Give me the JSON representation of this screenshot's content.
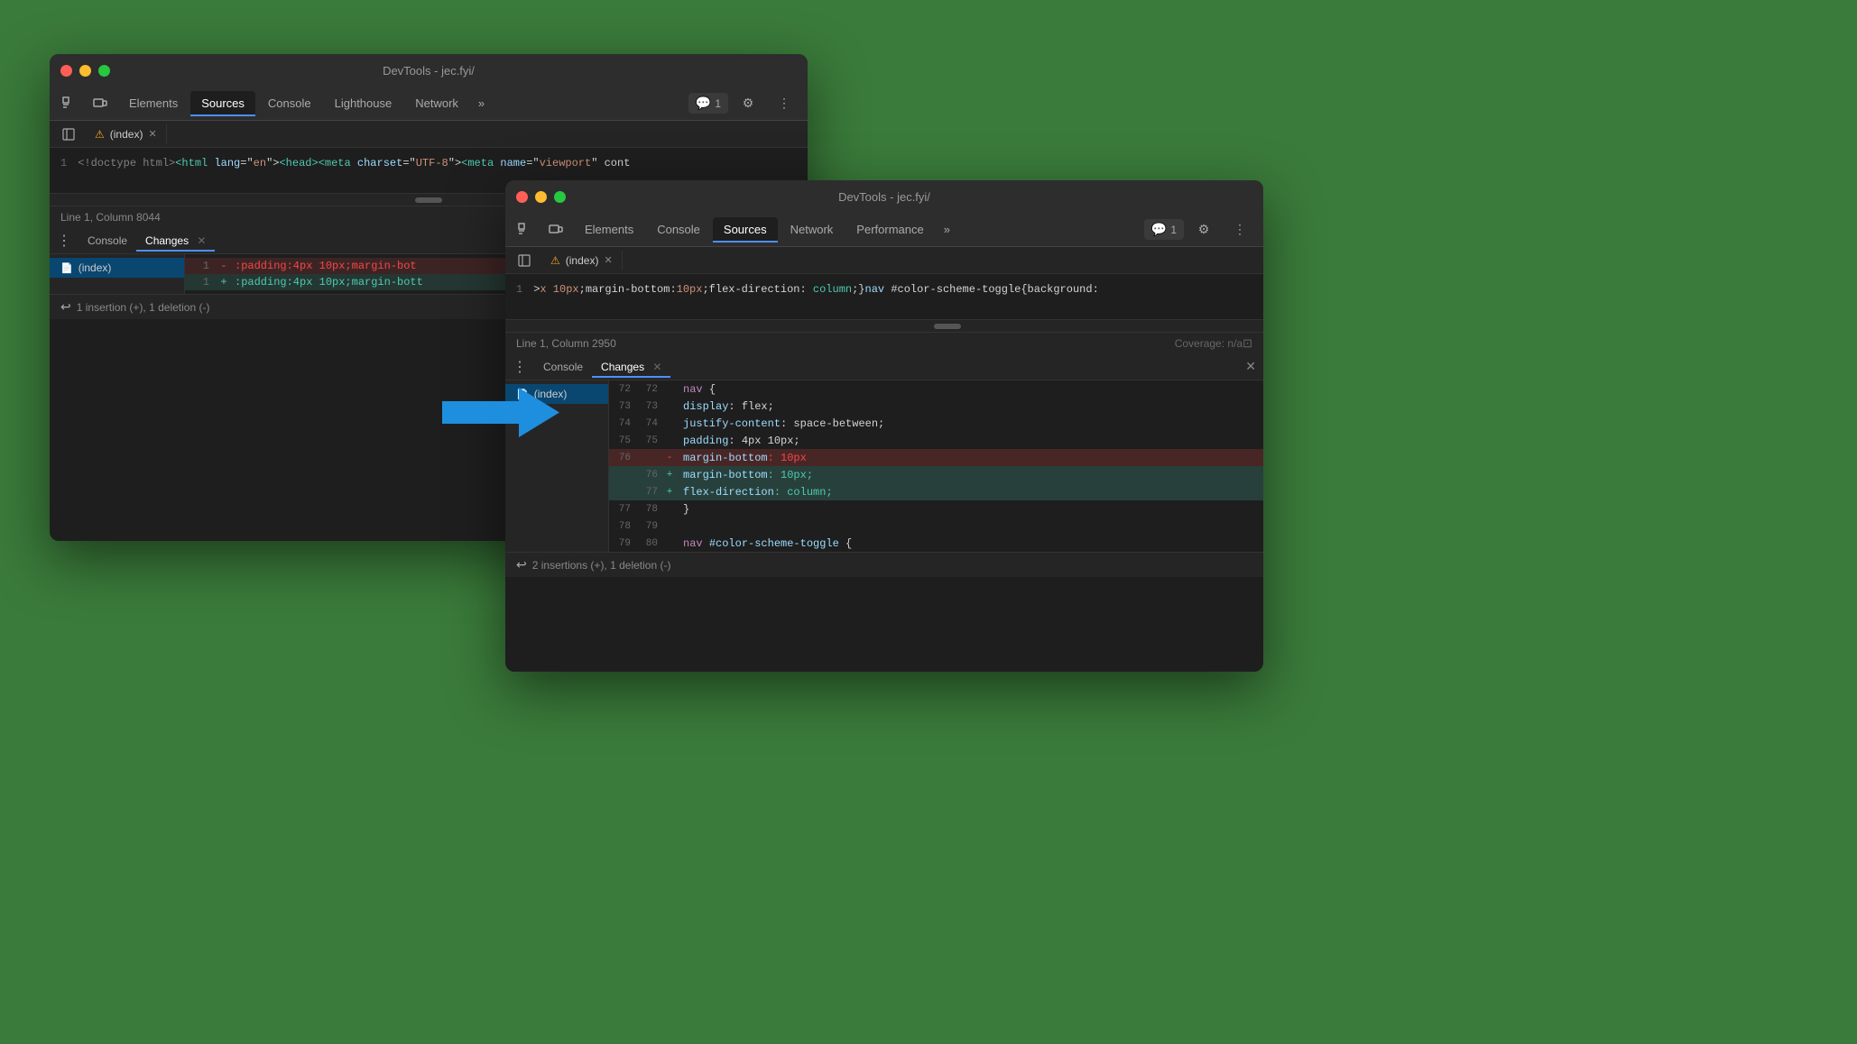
{
  "window_back": {
    "title": "DevTools - jec.fyi/",
    "tabs": [
      "Elements",
      "Sources",
      "Console",
      "Lighthouse",
      "Network",
      "»"
    ],
    "active_tab": "Sources",
    "file_tab": "(index)",
    "code_line": "<!doctype html><html lang=\"en\"><head><meta charset=\"UTF-8\"><meta name=\"viewport\" conte",
    "line_num": "1",
    "status": "Line 1, Column 8044",
    "panel_tabs": [
      "Console",
      "Changes"
    ],
    "active_panel_tab": "Changes",
    "changes_file": "(index)",
    "diff_lines": [
      {
        "old_num": "1",
        "new_num": "",
        "sign": "-",
        "code": ":padding:4px 10px;margin-bot",
        "type": "removed"
      },
      {
        "old_num": "",
        "new_num": "1",
        "sign": "+",
        "code": ":padding:4px 10px;margin-bott",
        "type": "added"
      }
    ],
    "footer": "1 insertion (+), 1 deletion (-)",
    "badge": "1"
  },
  "window_front": {
    "title": "DevTools - jec.fyi/",
    "tabs": [
      "Elements",
      "Console",
      "Sources",
      "Network",
      "Performance",
      "»"
    ],
    "active_tab": "Sources",
    "file_tab": "(index)",
    "code_line": ">x 10px;margin-bottom:10px;flex-direction: column;}nav #color-scheme-toggle{background:",
    "line_num": "1",
    "status": "Line 1, Column 2950",
    "coverage": "Coverage: n/a",
    "panel_tabs": [
      "Console",
      "Changes"
    ],
    "active_panel_tab": "Changes",
    "changes_file": "(index)",
    "diff_rows": [
      {
        "old_num": "72",
        "new_num": "72",
        "sign": "",
        "code": "        nav {",
        "type": "context"
      },
      {
        "old_num": "73",
        "new_num": "73",
        "sign": "",
        "code": "          display: flex;",
        "type": "context"
      },
      {
        "old_num": "74",
        "new_num": "74",
        "sign": "",
        "code": "          justify-content: space-between;",
        "type": "context"
      },
      {
        "old_num": "75",
        "new_num": "75",
        "sign": "",
        "code": "          padding: 4px 10px;",
        "type": "context"
      },
      {
        "old_num": "76",
        "new_num": "",
        "sign": "-",
        "code": "          margin-bottom: 10px",
        "type": "removed"
      },
      {
        "old_num": "",
        "new_num": "76",
        "sign": "+",
        "code": "          margin-bottom: 10px;",
        "type": "added"
      },
      {
        "old_num": "",
        "new_num": "77",
        "sign": "+",
        "code": "          flex-direction: column;",
        "type": "added"
      },
      {
        "old_num": "77",
        "new_num": "78",
        "sign": "",
        "code": "        }",
        "type": "context"
      },
      {
        "old_num": "78",
        "new_num": "79",
        "sign": "",
        "code": "",
        "type": "context"
      },
      {
        "old_num": "79",
        "new_num": "80",
        "sign": "",
        "code": "        nav #color-scheme-toggle {",
        "type": "context"
      }
    ],
    "footer": "2 insertions (+), 1 deletion (-)",
    "badge": "1"
  },
  "arrow": {
    "color": "#1e8fdf"
  }
}
